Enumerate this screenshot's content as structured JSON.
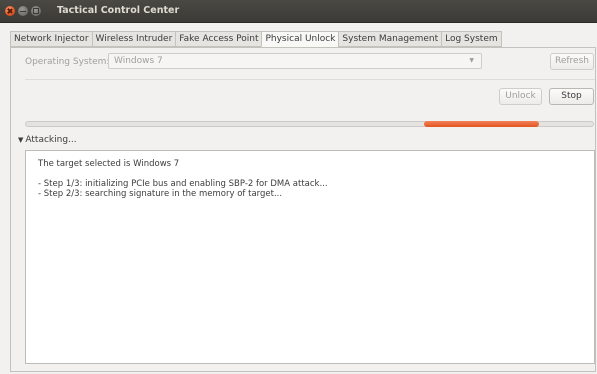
{
  "window": {
    "title": "Tactical Control Center"
  },
  "tabs": [
    {
      "label": "Network Injector"
    },
    {
      "label": "Wireless Intruder"
    },
    {
      "label": "Fake Access Point"
    },
    {
      "label": "Physical Unlock",
      "active": true
    },
    {
      "label": "System Management"
    },
    {
      "label": "Log System"
    }
  ],
  "form": {
    "os_label": "Operating System:",
    "os_value": "Windows 7",
    "refresh_label": "Refresh",
    "unlock_label": "Unlock",
    "stop_label": "Stop"
  },
  "progress": {
    "state": "indeterminate",
    "color": "#e2541f"
  },
  "attack": {
    "expander_label": "Attacking...",
    "lines": [
      "The target selected is Windows 7",
      "- Step 1/3: initializing PCIe bus and enabling SBP-2 for DMA attack...",
      "- Step 2/3: searching signature in the memory of target..."
    ]
  },
  "icons": {
    "close": "close-icon",
    "minimize": "minimize-icon",
    "maximize": "maximize-icon",
    "combo_arrow": "chevron-down-icon",
    "expander_arrow": "triangle-down-icon"
  }
}
